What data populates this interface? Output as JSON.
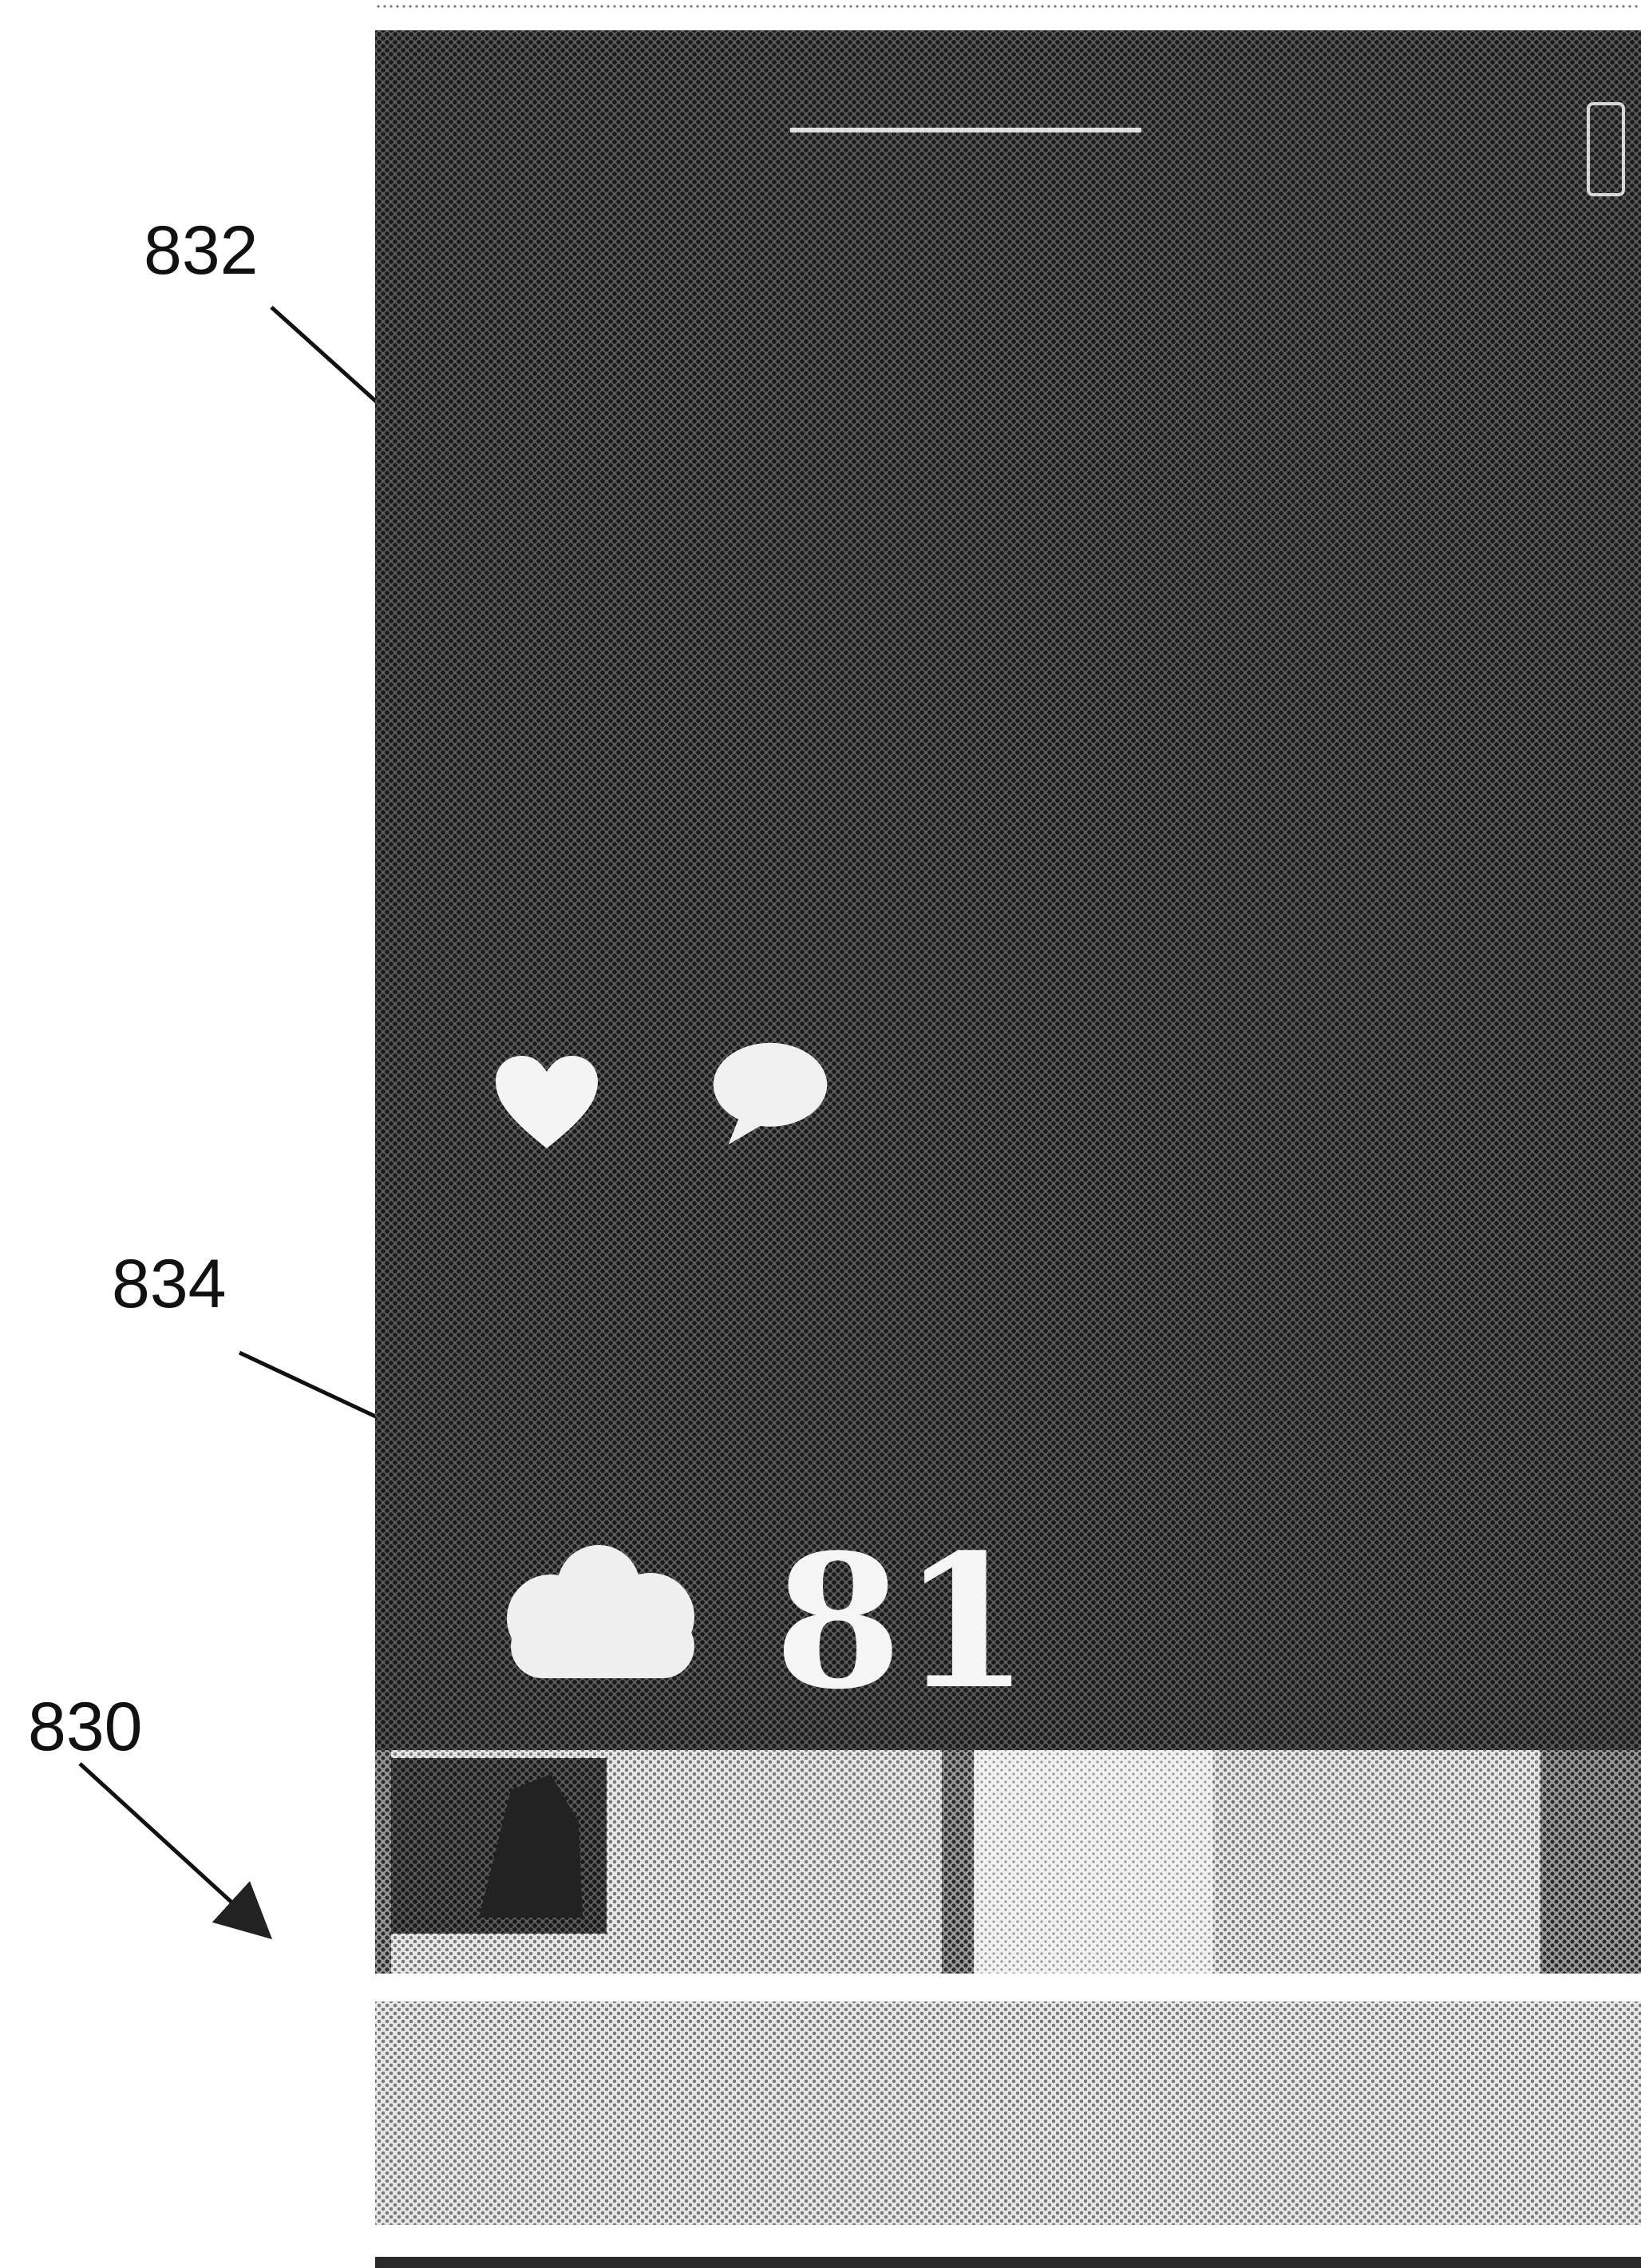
{
  "annotations": {
    "ref_832": "832",
    "ref_834": "834",
    "ref_830": "830"
  },
  "status_bar": {
    "left": "",
    "battery_icon": "battery-icon"
  },
  "nav": {
    "title": "",
    "subtitle": ""
  },
  "post": {
    "lines": [
      "",
      "",
      "",
      "",
      ""
    ],
    "author": "",
    "like_icon": "heart-icon",
    "comment_icon": "speech-bubble-icon"
  },
  "score": {
    "icon": "cloud-icon",
    "value": "81",
    "caption": ""
  },
  "cards": {
    "card1": {
      "thumb_label": "",
      "line1": "",
      "line2": ""
    },
    "card2": {
      "line1": "",
      "line2": ""
    }
  },
  "bottom_bar": {
    "label": ""
  },
  "colors": {
    "screen_background": "#3c3c3c",
    "text": "#e8e8e8",
    "card_background": "#e0e0e0",
    "annotation": "#111111"
  }
}
